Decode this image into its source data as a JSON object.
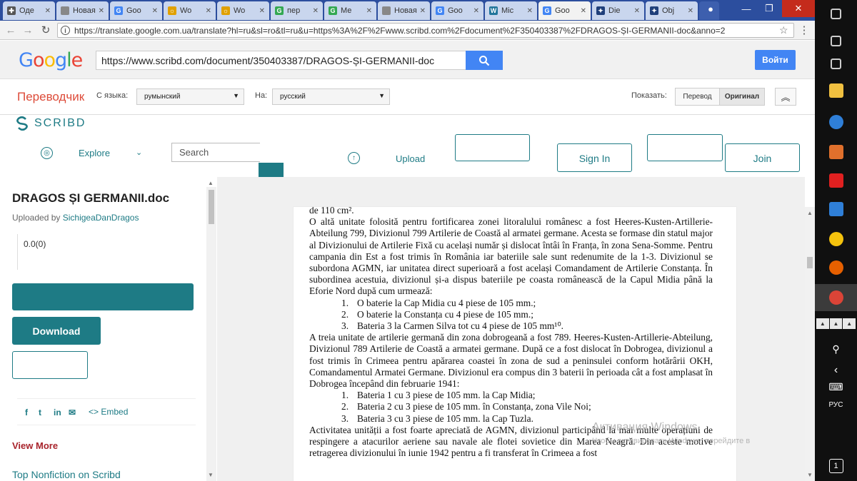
{
  "browser": {
    "tabs": [
      {
        "label": "Оде",
        "fav": "✚",
        "color": "#555"
      },
      {
        "label": "Новая в",
        "fav": "",
        "color": "#888"
      },
      {
        "label": "Goo",
        "fav": "G",
        "color": "#4285f4"
      },
      {
        "label": "Wo",
        "fav": "☼",
        "color": "#e0a000"
      },
      {
        "label": "Wo",
        "fav": "☼",
        "color": "#e0a000"
      },
      {
        "label": "пер",
        "fav": "G",
        "color": "#34a853"
      },
      {
        "label": "Ме",
        "fav": "G",
        "color": "#34a853"
      },
      {
        "label": "Новая в",
        "fav": "",
        "color": "#888"
      },
      {
        "label": "Goo",
        "fav": "G",
        "color": "#4285f4"
      },
      {
        "label": "Mic",
        "fav": "W",
        "color": "#21759b"
      },
      {
        "label": "Goo",
        "fav": "G",
        "color": "#4285f4"
      },
      {
        "label": "Die",
        "fav": "✦",
        "color": "#1f3f7a"
      },
      {
        "label": "Obj",
        "fav": "✦",
        "color": "#1f3f7a"
      }
    ],
    "active_tab_index": 10,
    "url": "https://translate.google.com.ua/translate?hl=ru&sl=ro&tl=ru&u=https%3A%2F%2Fwww.scribd.com%2Fdocument%2F350403387%2FDRAGOS-ȘI-GERMANII-doc&anno=2"
  },
  "google": {
    "logo": "Google",
    "search_value": "https://www.scribd.com/document/350403387/DRAGOS-ȘI-GERMANII-doc",
    "signin_label": "Войти"
  },
  "translate": {
    "title": "Переводчик",
    "from_label": "С языка:",
    "from_value": "румынский",
    "to_label": "На:",
    "to_value": "русский",
    "show_label": "Показать:",
    "btn_translation": "Перевод",
    "btn_original": "Оригинал"
  },
  "scribd": {
    "logo": "SCRIBD",
    "explore": "Explore",
    "search_placeholder": "Search",
    "upload": "Upload",
    "signin": "Sign In",
    "join": "Join"
  },
  "sidebar": {
    "doc_title": "DRAGOS ȘI GERMANII.doc",
    "uploaded_by": "Uploaded by",
    "uploader": "SichigeaDanDragos",
    "rating": "0.0(0)",
    "download": "Download",
    "share": [
      "f",
      "t",
      "in",
      "✉"
    ],
    "embed": "<> Embed",
    "view_more": "View More",
    "top_nonfiction": "Top Nonfiction on Scribd"
  },
  "document": {
    "paragraphs": [
      {
        "type": "p",
        "text": "de 110 cm²."
      },
      {
        "type": "p",
        "text": "O altă unitate folosită pentru fortificarea zonei litoralului românesc a fost Heeres-Kusten-Artillerie-Abteilung 799, Divizionul 799 Artilerie de Coastă al armatei germane. Acesta se formase din statul major al Divizionului de Artilerie Fixă cu același număr și dislocat întâi în Franța, în zona Sena-Somme. Pentru campania din Est a fost trimis în România iar bateriile sale sunt redenumite de la 1-3. Divizionul se subordona AGMN, iar unitatea direct superioară a fost același Comandament de Artilerie Constanța. În subordinea acestuia, divizionul și-a dispus bateriile pe coasta românească de la Capul Midia până la Eforie Nord după cum urmează:"
      },
      {
        "type": "li",
        "n": "1.",
        "text": "O baterie la Cap Midia cu 4 piese de 105 mm.;"
      },
      {
        "type": "li",
        "n": "2.",
        "text": "O baterie la Constanța cu 4 piese de 105 mm.;"
      },
      {
        "type": "li",
        "n": "3.",
        "text": "Bateria 3 la Carmen Silva tot cu 4 piese de 105 mm¹⁰."
      },
      {
        "type": "p",
        "text": "A treia unitate de artilerie germană din zona dobrogeană a fost 789. Heeres-Kusten-Artillerie-Abteilung, Divizionul 789 Artilerie de Coastă a armatei germane. După ce a fost dislocat în Dobrogea, divizionul a fost trimis în Crimeea pentru apărarea coastei în zona de sud a peninsulei conform hotărârii OKH, Comandamentul Armatei Germane. Divizionul era compus din 3 baterii în perioada cât a fost amplasat în Dobrogea începând din februarie 1941:"
      },
      {
        "type": "li",
        "n": "1.",
        "text": "Bateria 1 cu 3 piese de 105 mm. la Cap Midia;"
      },
      {
        "type": "li",
        "n": "2.",
        "text": "Bateria 2 cu 3 piese de 105 mm. în Constanța, zona Vile Noi;"
      },
      {
        "type": "li",
        "n": "3.",
        "text": "Bateria 3 cu 3 piese de 105 mm. la Cap Tuzla."
      },
      {
        "type": "p",
        "text": "Activitatea unității a fost foarte apreciată de AGMN, divizionul participând la mai multe operațiuni de respingere a atacurilor aeriene sau navale ale flotei sovietice din Marea Neagră. Din aceste motive retragerea divizionului în iunie 1942 pentru a fi transferat în Crimeea a fost"
      }
    ]
  },
  "watermark": {
    "line1": "Активация Windows",
    "line2": "Чтобы активировать Windows, перейдите в"
  },
  "taskbar": {
    "lang": "РУС",
    "kb_keys": [
      "▲",
      "▲",
      "▲"
    ],
    "icons": [
      {
        "name": "action-center-icon",
        "color": "#cccccc"
      },
      {
        "name": "search-icon",
        "color": "#cccccc"
      },
      {
        "name": "task-view-icon",
        "color": "#cccccc"
      },
      {
        "name": "file-explorer-icon",
        "color": "#f0c040"
      },
      {
        "name": "edge-icon",
        "color": "#2f7fd8"
      },
      {
        "name": "media-player-icon",
        "color": "#e0702c"
      },
      {
        "name": "yandex-icon",
        "color": "#e02020"
      },
      {
        "name": "store-icon",
        "color": "#2f7fd8"
      },
      {
        "name": "chrome-icon",
        "color": "#f4c20d"
      },
      {
        "name": "firefox-icon",
        "color": "#e66000"
      },
      {
        "name": "chrome-active-icon",
        "color": "#db4437"
      }
    ]
  }
}
